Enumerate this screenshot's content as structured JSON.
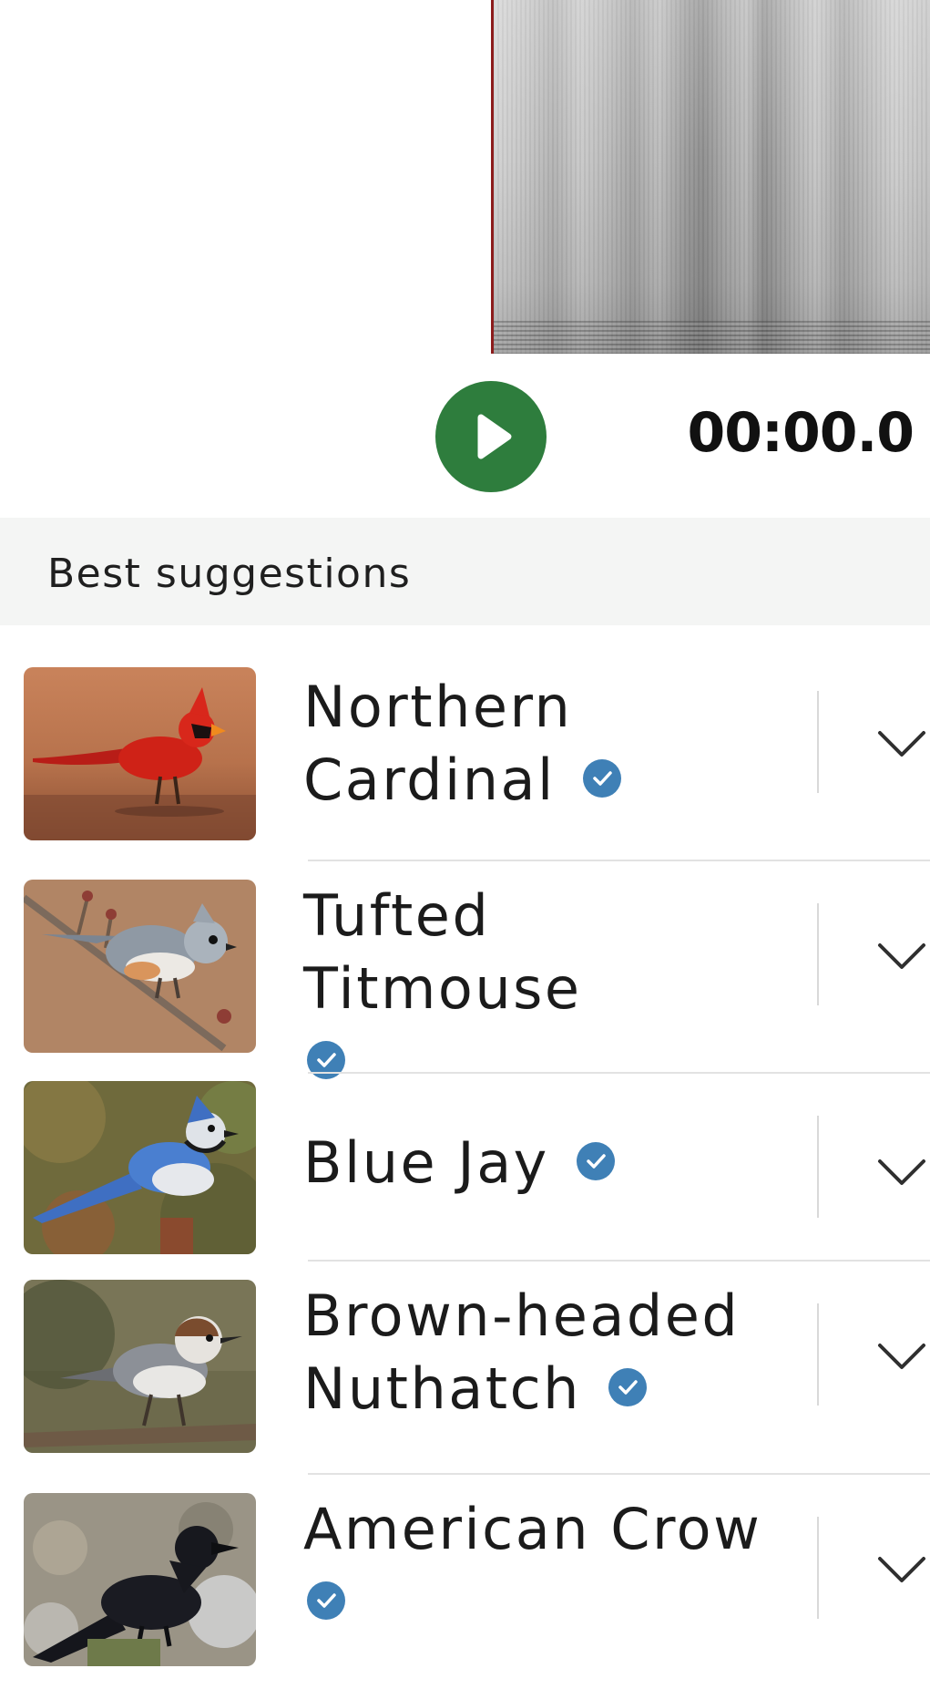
{
  "player": {
    "time": "00:00.0",
    "play_icon": "play-icon",
    "play_button_color": "#2e7d3d",
    "playhead_color": "#8c1c1c"
  },
  "section": {
    "title": "Best suggestions"
  },
  "suggestions": [
    {
      "name_line1": "Northern",
      "name_line2": "Cardinal",
      "verified": true
    },
    {
      "name_line1": "Tufted Titmouse",
      "name_line2": "",
      "verified": true
    },
    {
      "name_line1": "Blue Jay",
      "name_line2": "",
      "verified": true
    },
    {
      "name_line1": "Brown-headed",
      "name_line2": "Nuthatch",
      "verified": true
    },
    {
      "name_line1": "American Crow",
      "name_line2": "",
      "verified": true
    }
  ],
  "icons": {
    "verified": "verified-check-icon",
    "expand": "chevron-down-icon"
  },
  "colors": {
    "verified_badge": "#3f80b6",
    "section_background": "#f4f5f4"
  }
}
